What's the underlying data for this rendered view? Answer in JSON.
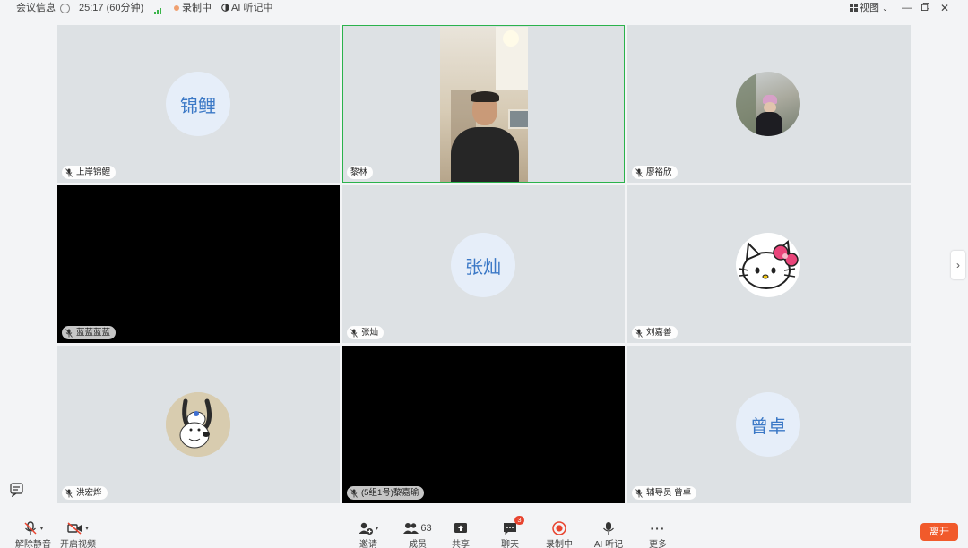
{
  "topbar": {
    "meeting_info": "会议信息",
    "duration": "25:17 (60分钟)",
    "recording": "录制中",
    "ai_notes": "AI 听记中",
    "view_label": "视图"
  },
  "tiles": [
    {
      "name": "上岸锦鲤",
      "avatar_text": "锦鲤",
      "type": "text-avatar"
    },
    {
      "name": "黎林",
      "type": "video"
    },
    {
      "name": "廖裕欣",
      "type": "photo-avatar"
    },
    {
      "name": "蓝蓝蓝蓝",
      "type": "black"
    },
    {
      "name": "张灿",
      "avatar_text": "张灿",
      "type": "text-avatar"
    },
    {
      "name": "刘嘉善",
      "type": "hello-kitty-avatar"
    },
    {
      "name": "洪宏烨",
      "type": "snoopy-avatar"
    },
    {
      "name": "(5组1号)黎嘉瑜",
      "type": "black"
    },
    {
      "name": "辅导员 曾卓",
      "avatar_text": "曾卓",
      "type": "text-avatar"
    }
  ],
  "toolbar": {
    "unmute": "解除静音",
    "start_video": "开启视频",
    "invite": "邀请",
    "members": "成员",
    "members_count": "63",
    "share": "共享",
    "chat": "聊天",
    "chat_badge": "3",
    "recording": "录制中",
    "ai_notes": "AI 听记",
    "more": "更多",
    "leave": "离开"
  },
  "colors": {
    "active_speaker_border": "#2bb24c",
    "leave_button": "#f15a2b",
    "avatar_text": "#3b78c6",
    "chat_badge": "#e8432e"
  }
}
